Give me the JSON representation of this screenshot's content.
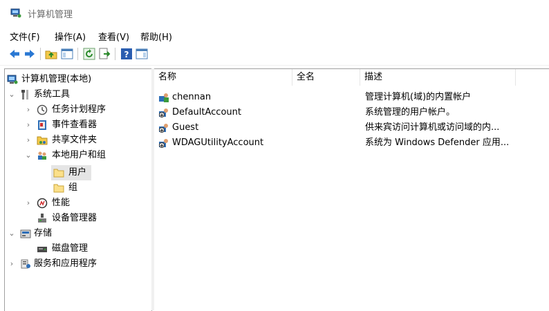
{
  "window": {
    "title": "计算机管理"
  },
  "menu": [
    {
      "label": "文件(F)"
    },
    {
      "label": "操作(A)"
    },
    {
      "label": "查看(V)"
    },
    {
      "label": "帮助(H)"
    }
  ],
  "tree": {
    "root": "计算机管理(本地)",
    "system_tools": "系统工具",
    "task_scheduler": "任务计划程序",
    "event_viewer": "事件查看器",
    "shared_folders": "共享文件夹",
    "local_users_groups": "本地用户和组",
    "users": "用户",
    "groups": "组",
    "performance": "性能",
    "device_manager": "设备管理器",
    "storage": "存储",
    "disk_management": "磁盘管理",
    "services_apps": "服务和应用程序"
  },
  "list": {
    "columns": [
      "名称",
      "全名",
      "描述"
    ],
    "rows": [
      {
        "name": "chennan",
        "fullname": "",
        "description": "管理计算机(域)的内置帐户"
      },
      {
        "name": "DefaultAccount",
        "fullname": "",
        "description": "系统管理的用户帐户。"
      },
      {
        "name": "Guest",
        "fullname": "",
        "description": "供来宾访问计算机或访问域的内..."
      },
      {
        "name": "WDAGUtilityAccount",
        "fullname": "",
        "description": "系统为 Windows Defender 应用..."
      }
    ]
  },
  "colors": {
    "selection": "#e5e5e5",
    "folder": "#f3d26b",
    "border": "#a0a0a0"
  }
}
